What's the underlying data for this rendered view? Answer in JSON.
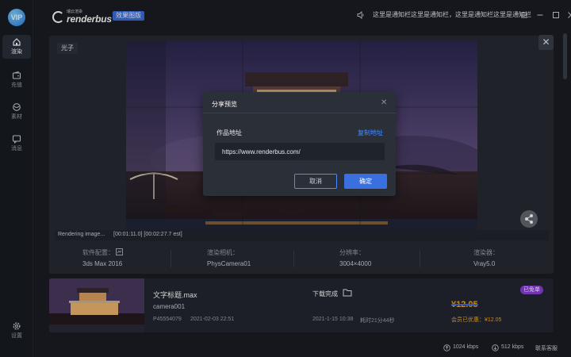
{
  "sidebar": {
    "vip": "VIP",
    "items": [
      {
        "label": "渲染",
        "icon": "home-icon"
      },
      {
        "label": "充值",
        "icon": "wallet-icon"
      },
      {
        "label": "素材",
        "icon": "material-icon"
      },
      {
        "label": "消息",
        "icon": "message-icon"
      },
      {
        "label": "设置",
        "icon": "settings-icon"
      }
    ]
  },
  "header": {
    "logo_sub": "瑞云渲染",
    "logo_text": "renderbus",
    "edition": "效果图版",
    "notice": "这里是通知栏这里是通知栏，这里是通知栏这里是通知栏"
  },
  "preview": {
    "tag": "光子",
    "render_status": "Rendering image...",
    "render_time": "[00:01:11.0] [00:02:27.7 est]"
  },
  "meta": {
    "software_k": "软件配置：",
    "software_v": "3ds Max 2016",
    "camera_k": "渲染相机：",
    "camera_v": "PhysCamera01",
    "resolution_k": "分辨率：",
    "resolution_v": "3004×4000",
    "renderer_k": "渲染器：",
    "renderer_v": "Vray5.0"
  },
  "task": {
    "name": "文字标题.max",
    "camera": "camera001",
    "id": "P45554079",
    "date": "2021-02-03 22:51",
    "status": "下载完成",
    "finish_date": "2021-1-15 10:38",
    "duration": "耗时21分44秒",
    "badge": "已免单",
    "price": "¥12.05",
    "member_price": "会员已优惠：¥12.05"
  },
  "modal": {
    "title": "分享预览",
    "label": "作品地址",
    "copy": "复制地址",
    "url": "https://www.renderbus.com/",
    "cancel": "取消",
    "ok": "确定"
  },
  "statusbar": {
    "upload": "1024 kbps",
    "download": "512 kbps",
    "support": "联系客服"
  },
  "colors": {
    "accent": "#3a6fe0",
    "link": "#4a8cff",
    "price": "#f5a623",
    "badge": "#8b3fd9"
  }
}
